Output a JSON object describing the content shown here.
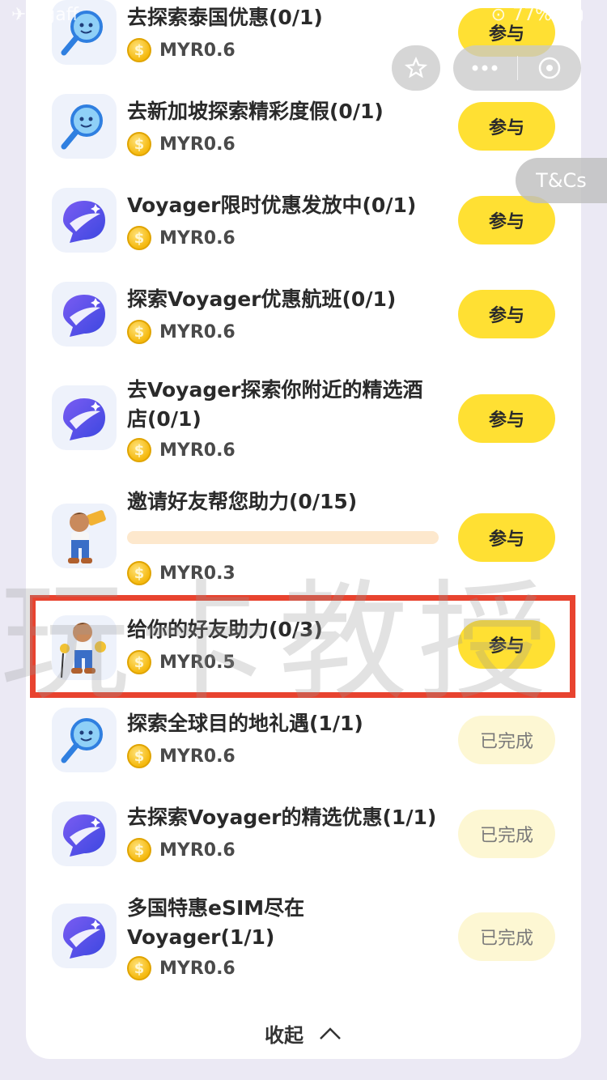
{
  "status_bar": {
    "left_text": "figaff",
    "battery": "77%"
  },
  "header": {
    "tcs_label": "T&Cs"
  },
  "tasks": [
    {
      "title": "去探索泰国优惠(0/1)",
      "reward": "MYR0.6",
      "button": "参与",
      "icon": "search-icon",
      "state": "join"
    },
    {
      "title": "去新加坡探索精彩度假(0/1)",
      "reward": "MYR0.6",
      "button": "参与",
      "icon": "search-icon",
      "state": "join"
    },
    {
      "title": "Voyager限时优惠发放中(0/1)",
      "reward": "MYR0.6",
      "button": "参与",
      "icon": "voyager-logo-icon",
      "state": "join"
    },
    {
      "title": "探索Voyager优惠航班(0/1)",
      "reward": "MYR0.6",
      "button": "参与",
      "icon": "voyager-logo-icon",
      "state": "join"
    },
    {
      "title": "去Voyager探索你附近的精选酒店(0/1)",
      "reward": "MYR0.6",
      "button": "参与",
      "icon": "voyager-logo-icon",
      "state": "join"
    },
    {
      "title": "邀请好友帮您助力(0/15)",
      "reward": "MYR0.3",
      "button": "参与",
      "icon": "megaphone-character-icon",
      "state": "join",
      "progress": 0
    },
    {
      "title": "给你的好友助力(0/3)",
      "reward": "MYR0.5",
      "button": "参与",
      "icon": "cheer-character-icon",
      "state": "join"
    },
    {
      "title": "探索全球目的地礼遇(1/1)",
      "reward": "MYR0.6",
      "button": "已完成",
      "icon": "search-icon",
      "state": "done"
    },
    {
      "title": "去探索Voyager的精选优惠(1/1)",
      "reward": "MYR0.6",
      "button": "已完成",
      "icon": "voyager-logo-icon",
      "state": "done"
    },
    {
      "title": "多国特惠eSIM尽在Voyager(1/1)",
      "reward": "MYR0.6",
      "button": "已完成",
      "icon": "voyager-logo-icon",
      "state": "done"
    }
  ],
  "footer": {
    "collapse_label": "收起"
  },
  "watermark": {
    "text": "玩卡教授"
  },
  "colors": {
    "accent": "#ffe033",
    "done_bg": "#fdf7d3",
    "highlight": "#e8432f",
    "coin": "#f5b90e"
  }
}
